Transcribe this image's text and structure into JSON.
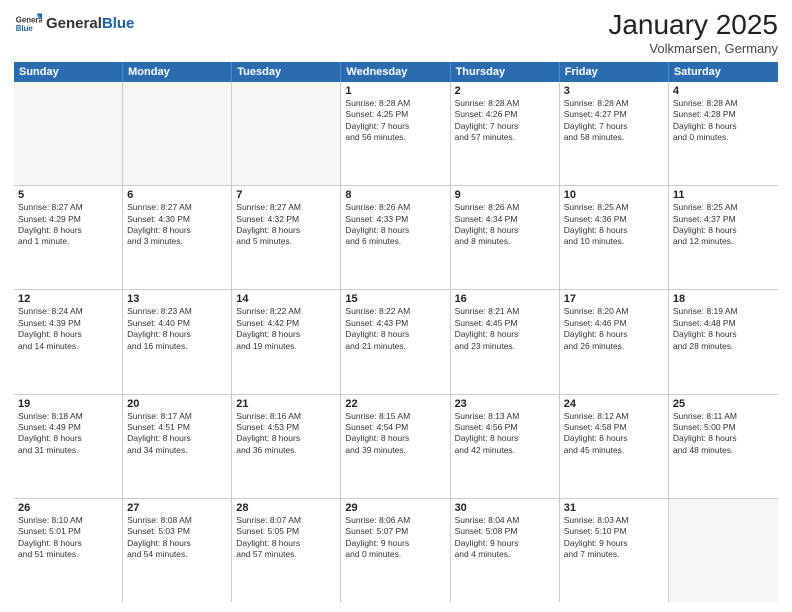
{
  "logo": {
    "general": "General",
    "blue": "Blue"
  },
  "header": {
    "title": "January 2025",
    "subtitle": "Volkmarsen, Germany"
  },
  "weekdays": [
    "Sunday",
    "Monday",
    "Tuesday",
    "Wednesday",
    "Thursday",
    "Friday",
    "Saturday"
  ],
  "weeks": [
    [
      {
        "day": "",
        "info": "",
        "empty": true
      },
      {
        "day": "",
        "info": "",
        "empty": true
      },
      {
        "day": "",
        "info": "",
        "empty": true
      },
      {
        "day": "1",
        "info": "Sunrise: 8:28 AM\nSunset: 4:25 PM\nDaylight: 7 hours\nand 56 minutes.",
        "empty": false
      },
      {
        "day": "2",
        "info": "Sunrise: 8:28 AM\nSunset: 4:26 PM\nDaylight: 7 hours\nand 57 minutes.",
        "empty": false
      },
      {
        "day": "3",
        "info": "Sunrise: 8:28 AM\nSunset: 4:27 PM\nDaylight: 7 hours\nand 58 minutes.",
        "empty": false
      },
      {
        "day": "4",
        "info": "Sunrise: 8:28 AM\nSunset: 4:28 PM\nDaylight: 8 hours\nand 0 minutes.",
        "empty": false
      }
    ],
    [
      {
        "day": "5",
        "info": "Sunrise: 8:27 AM\nSunset: 4:29 PM\nDaylight: 8 hours\nand 1 minute.",
        "empty": false
      },
      {
        "day": "6",
        "info": "Sunrise: 8:27 AM\nSunset: 4:30 PM\nDaylight: 8 hours\nand 3 minutes.",
        "empty": false
      },
      {
        "day": "7",
        "info": "Sunrise: 8:27 AM\nSunset: 4:32 PM\nDaylight: 8 hours\nand 5 minutes.",
        "empty": false
      },
      {
        "day": "8",
        "info": "Sunrise: 8:26 AM\nSunset: 4:33 PM\nDaylight: 8 hours\nand 6 minutes.",
        "empty": false
      },
      {
        "day": "9",
        "info": "Sunrise: 8:26 AM\nSunset: 4:34 PM\nDaylight: 8 hours\nand 8 minutes.",
        "empty": false
      },
      {
        "day": "10",
        "info": "Sunrise: 8:25 AM\nSunset: 4:36 PM\nDaylight: 8 hours\nand 10 minutes.",
        "empty": false
      },
      {
        "day": "11",
        "info": "Sunrise: 8:25 AM\nSunset: 4:37 PM\nDaylight: 8 hours\nand 12 minutes.",
        "empty": false
      }
    ],
    [
      {
        "day": "12",
        "info": "Sunrise: 8:24 AM\nSunset: 4:39 PM\nDaylight: 8 hours\nand 14 minutes.",
        "empty": false
      },
      {
        "day": "13",
        "info": "Sunrise: 8:23 AM\nSunset: 4:40 PM\nDaylight: 8 hours\nand 16 minutes.",
        "empty": false
      },
      {
        "day": "14",
        "info": "Sunrise: 8:22 AM\nSunset: 4:42 PM\nDaylight: 8 hours\nand 19 minutes.",
        "empty": false
      },
      {
        "day": "15",
        "info": "Sunrise: 8:22 AM\nSunset: 4:43 PM\nDaylight: 8 hours\nand 21 minutes.",
        "empty": false
      },
      {
        "day": "16",
        "info": "Sunrise: 8:21 AM\nSunset: 4:45 PM\nDaylight: 8 hours\nand 23 minutes.",
        "empty": false
      },
      {
        "day": "17",
        "info": "Sunrise: 8:20 AM\nSunset: 4:46 PM\nDaylight: 8 hours\nand 26 minutes.",
        "empty": false
      },
      {
        "day": "18",
        "info": "Sunrise: 8:19 AM\nSunset: 4:48 PM\nDaylight: 8 hours\nand 28 minutes.",
        "empty": false
      }
    ],
    [
      {
        "day": "19",
        "info": "Sunrise: 8:18 AM\nSunset: 4:49 PM\nDaylight: 8 hours\nand 31 minutes.",
        "empty": false
      },
      {
        "day": "20",
        "info": "Sunrise: 8:17 AM\nSunset: 4:51 PM\nDaylight: 8 hours\nand 34 minutes.",
        "empty": false
      },
      {
        "day": "21",
        "info": "Sunrise: 8:16 AM\nSunset: 4:53 PM\nDaylight: 8 hours\nand 36 minutes.",
        "empty": false
      },
      {
        "day": "22",
        "info": "Sunrise: 8:15 AM\nSunset: 4:54 PM\nDaylight: 8 hours\nand 39 minutes.",
        "empty": false
      },
      {
        "day": "23",
        "info": "Sunrise: 8:13 AM\nSunset: 4:56 PM\nDaylight: 8 hours\nand 42 minutes.",
        "empty": false
      },
      {
        "day": "24",
        "info": "Sunrise: 8:12 AM\nSunset: 4:58 PM\nDaylight: 8 hours\nand 45 minutes.",
        "empty": false
      },
      {
        "day": "25",
        "info": "Sunrise: 8:11 AM\nSunset: 5:00 PM\nDaylight: 8 hours\nand 48 minutes.",
        "empty": false
      }
    ],
    [
      {
        "day": "26",
        "info": "Sunrise: 8:10 AM\nSunset: 5:01 PM\nDaylight: 8 hours\nand 51 minutes.",
        "empty": false
      },
      {
        "day": "27",
        "info": "Sunrise: 8:08 AM\nSunset: 5:03 PM\nDaylight: 8 hours\nand 54 minutes.",
        "empty": false
      },
      {
        "day": "28",
        "info": "Sunrise: 8:07 AM\nSunset: 5:05 PM\nDaylight: 8 hours\nand 57 minutes.",
        "empty": false
      },
      {
        "day": "29",
        "info": "Sunrise: 8:06 AM\nSunset: 5:07 PM\nDaylight: 9 hours\nand 0 minutes.",
        "empty": false
      },
      {
        "day": "30",
        "info": "Sunrise: 8:04 AM\nSunset: 5:08 PM\nDaylight: 9 hours\nand 4 minutes.",
        "empty": false
      },
      {
        "day": "31",
        "info": "Sunrise: 8:03 AM\nSunset: 5:10 PM\nDaylight: 9 hours\nand 7 minutes.",
        "empty": false
      },
      {
        "day": "",
        "info": "",
        "empty": true
      }
    ]
  ]
}
